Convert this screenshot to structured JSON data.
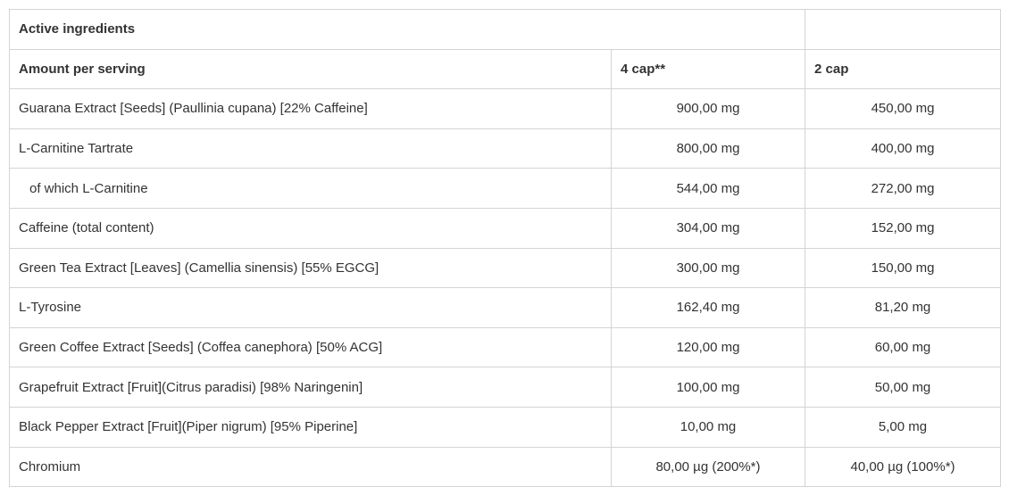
{
  "table": {
    "title": "Active ingredients",
    "header": {
      "label": "Amount per serving",
      "col1": "4 cap**",
      "col2": "2 cap"
    },
    "rows": [
      {
        "name": "Guarana Extract [Seeds] (Paullinia cupana) [22% Caffeine]",
        "v1": "900,00 mg",
        "v2": "450,00 mg"
      },
      {
        "name": "L-Carnitine Tartrate",
        "v1": "800,00 mg",
        "v2": "400,00 mg"
      },
      {
        "name": "of which L-Carnitine",
        "v1": "544,00 mg",
        "v2": "272,00 mg"
      },
      {
        "name": "Caffeine (total content)",
        "v1": "304,00 mg",
        "v2": "152,00 mg"
      },
      {
        "name": "Green Tea Extract [Leaves] (Camellia sinensis) [55% EGCG]",
        "v1": "300,00 mg",
        "v2": "150,00 mg"
      },
      {
        "name": "L-Tyrosine",
        "v1": "162,40 mg",
        "v2": "81,20 mg"
      },
      {
        "name": "Green Coffee Extract [Seeds] (Coffea canephora) [50% ACG]",
        "v1": "120,00 mg",
        "v2": "60,00 mg"
      },
      {
        "name": "Grapefruit Extract [Fruit](Citrus paradisi) [98% Naringenin]",
        "v1": "100,00 mg",
        "v2": "50,00 mg"
      },
      {
        "name": "Black Pepper Extract [Fruit](Piper nigrum) [95% Piperine]",
        "v1": "10,00 mg",
        "v2": "5,00 mg"
      },
      {
        "name": "Chromium",
        "v1": "80,00 µg (200%*)",
        "v2": "40,00 µg (100%*)"
      }
    ]
  }
}
